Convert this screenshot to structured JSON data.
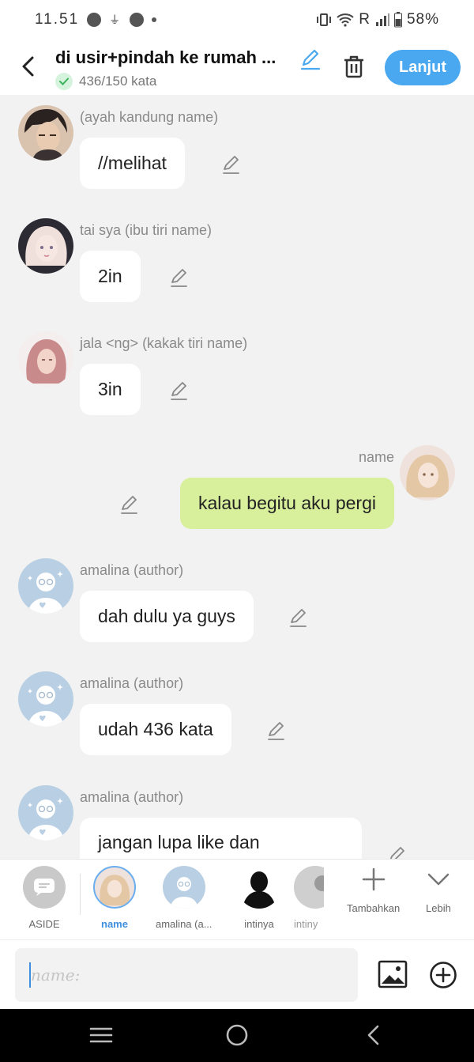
{
  "status_bar": {
    "time": "11.51",
    "carrier": "R",
    "battery": "58%"
  },
  "header": {
    "title": "di usir+pindah ke rumah ...",
    "word_count": "436/150 kata",
    "next_label": "Lanjut"
  },
  "messages": [
    {
      "sender": "(ayah kandung name)",
      "text": "//melihat",
      "side": "left",
      "avatar": "ayah-avatar"
    },
    {
      "sender": "tai sya (ibu tiri name)",
      "text": "2in",
      "side": "left",
      "avatar": "ibu-avatar"
    },
    {
      "sender": "jala <ng> (kakak tiri name)",
      "text": "3in",
      "side": "left",
      "avatar": "kakak-avatar"
    },
    {
      "sender": "name",
      "text": "kalau begitu aku pergi",
      "side": "right",
      "avatar": "name-avatar"
    },
    {
      "sender": "amalina (author)",
      "text": "dah dulu ya guys",
      "side": "left",
      "avatar": "author-avatar"
    },
    {
      "sender": "amalina (author)",
      "text": "udah 436 kata",
      "side": "left",
      "avatar": "author-avatar"
    },
    {
      "sender": "amalina (author)",
      "text": "jangan lupa like dan",
      "side": "left",
      "avatar": "author-avatar"
    }
  ],
  "characters": [
    {
      "label": "ASIDE",
      "active": false
    },
    {
      "label": "name",
      "active": true
    },
    {
      "label": "amalina (a...",
      "active": false
    },
    {
      "label": "intinya",
      "active": false
    },
    {
      "label": "intiny",
      "active": false
    }
  ],
  "tools": {
    "add_label": "Tambahkan",
    "more_label": "Lebih"
  },
  "input": {
    "placeholder": "name:"
  },
  "colors": {
    "accent": "#4aa8f0",
    "my_bubble": "#d8ef9c",
    "author_avatar": "#b9cfe3"
  }
}
